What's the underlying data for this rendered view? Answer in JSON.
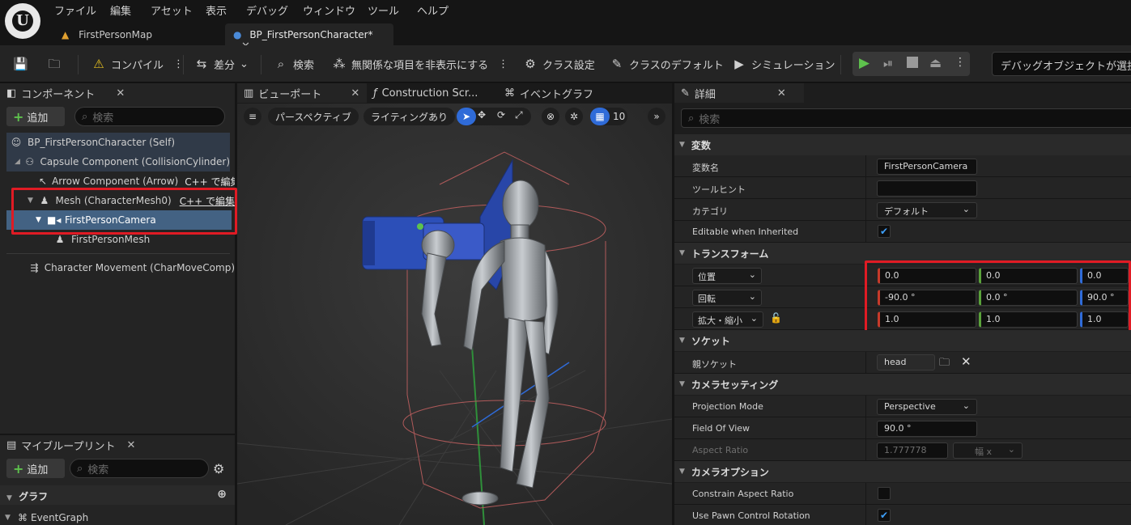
{
  "menu": {
    "items": [
      "ファイル",
      "編集",
      "アセット",
      "表示",
      "デバッグ",
      "ウィンドウ",
      "ツール",
      "ヘルプ"
    ]
  },
  "doc_tabs": {
    "map": "FirstPersonMap",
    "character": "BP_FirstPersonCharacter*"
  },
  "toolbar": {
    "compile": "コンパイル",
    "diff": "差分",
    "search": "検索",
    "hide_unrelated": "無関係な項目を非表示にする",
    "class_settings": "クラス設定",
    "class_defaults": "クラスのデフォルト",
    "simulation": "シミュレーション",
    "debug_object": "デバッグオブジェクトが選択さ"
  },
  "components": {
    "tab": "コンポーネント",
    "add": "追加",
    "search_placeholder": "検索",
    "tree": [
      {
        "label": "BP_FirstPersonCharacter (Self)",
        "icon": "person-icon"
      },
      {
        "label": "Capsule Component (CollisionCylinder)",
        "icon": "capsule-icon"
      },
      {
        "label": "Arrow Component (Arrow)",
        "icon": "arrow-icon",
        "extra": "C++ で編集"
      },
      {
        "label": "Mesh (CharacterMesh0)",
        "icon": "skeletal-mesh-icon",
        "extra": "C++ で編集"
      },
      {
        "label": "FirstPersonCamera",
        "icon": "camera-icon"
      },
      {
        "label": "FirstPersonMesh",
        "icon": "skeletal-mesh-icon"
      },
      {
        "label": "Character Movement (CharMoveComp)",
        "icon": "movement-icon"
      }
    ]
  },
  "my_blueprint": {
    "tab": "マイブループリント",
    "add": "追加",
    "search_placeholder": "検索",
    "graph_section": "グラフ",
    "event_graph": "EventGraph"
  },
  "viewport": {
    "tabs": [
      "ビューポート",
      "Construction Scr...",
      "イベントグラフ"
    ],
    "perspective": "パースペクティブ",
    "lighting": "ライティングあり",
    "grid_size": "10"
  },
  "details": {
    "tab": "詳細",
    "search_placeholder": "検索",
    "sections": {
      "variable": "変数",
      "transform": "トランスフォーム",
      "socket": "ソケット",
      "camera_settings": "カメラセッティング",
      "camera_options": "カメラオプション"
    },
    "variable": {
      "name_label": "変数名",
      "name_value": "FirstPersonCamera",
      "tooltip_label": "ツールヒント",
      "tooltip_value": "",
      "category_label": "カテゴリ",
      "category_value": "デフォルト",
      "editable_label": "Editable when Inherited",
      "editable_checked": true
    },
    "transform": {
      "location_label": "位置",
      "location": [
        "0.0",
        "0.0",
        "0.0"
      ],
      "rotation_label": "回転",
      "rotation": [
        "-90.0 °",
        "0.0 °",
        "90.0 °"
      ],
      "scale_label": "拡大・縮小",
      "scale": [
        "1.0",
        "1.0",
        "1.0"
      ]
    },
    "socket": {
      "parent_label": "親ソケット",
      "parent_value": "head"
    },
    "camera": {
      "projection_label": "Projection Mode",
      "projection_value": "Perspective",
      "fov_label": "Field Of View",
      "fov_value": "90.0 °",
      "aspect_label": "Aspect Ratio",
      "aspect_value": "1.777778",
      "aspect_preset": "幅 x"
    },
    "camera_options": {
      "constrain_label": "Constrain Aspect Ratio",
      "constrain_checked": false,
      "pawn_rotation_label": "Use Pawn Control Rotation",
      "pawn_rotation_checked": true
    }
  },
  "colors": {
    "highlight_red": "#e01b24",
    "selected_row": "#436283",
    "play_green": "#5ec24d"
  }
}
